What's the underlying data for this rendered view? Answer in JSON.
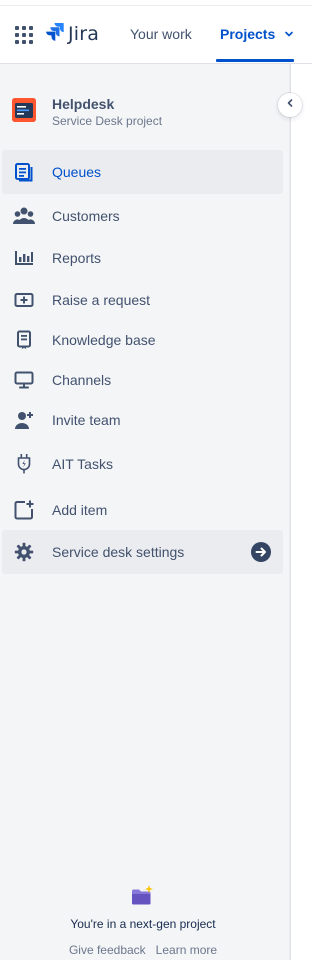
{
  "topnav": {
    "logo_text": "Jira",
    "your_work": "Your work",
    "projects": "Projects",
    "accent": "#0052CC"
  },
  "project": {
    "name": "Helpdesk",
    "type": "Service Desk project",
    "avatar_color": "#FF5630"
  },
  "sidebar": {
    "items": [
      {
        "label": "Queues",
        "icon": "queues-icon",
        "selected": true
      },
      {
        "label": "Customers",
        "icon": "customers-icon"
      },
      {
        "label": "Reports",
        "icon": "reports-icon"
      },
      {
        "label": "Raise a request",
        "icon": "raise-request-icon"
      },
      {
        "label": "Knowledge base",
        "icon": "knowledge-base-icon"
      },
      {
        "label": "Channels",
        "icon": "channels-icon"
      },
      {
        "label": "Invite team",
        "icon": "invite-team-icon"
      },
      {
        "label": "AIT Tasks",
        "icon": "plug-icon"
      },
      {
        "label": "Add item",
        "icon": "add-item-icon"
      },
      {
        "label": "Service desk settings",
        "icon": "gear-icon",
        "trailing_icon": "arrow-right-circle-icon"
      }
    ]
  },
  "footer": {
    "message": "You're in a next-gen project",
    "give_feedback": "Give feedback",
    "learn_more": "Learn more"
  }
}
